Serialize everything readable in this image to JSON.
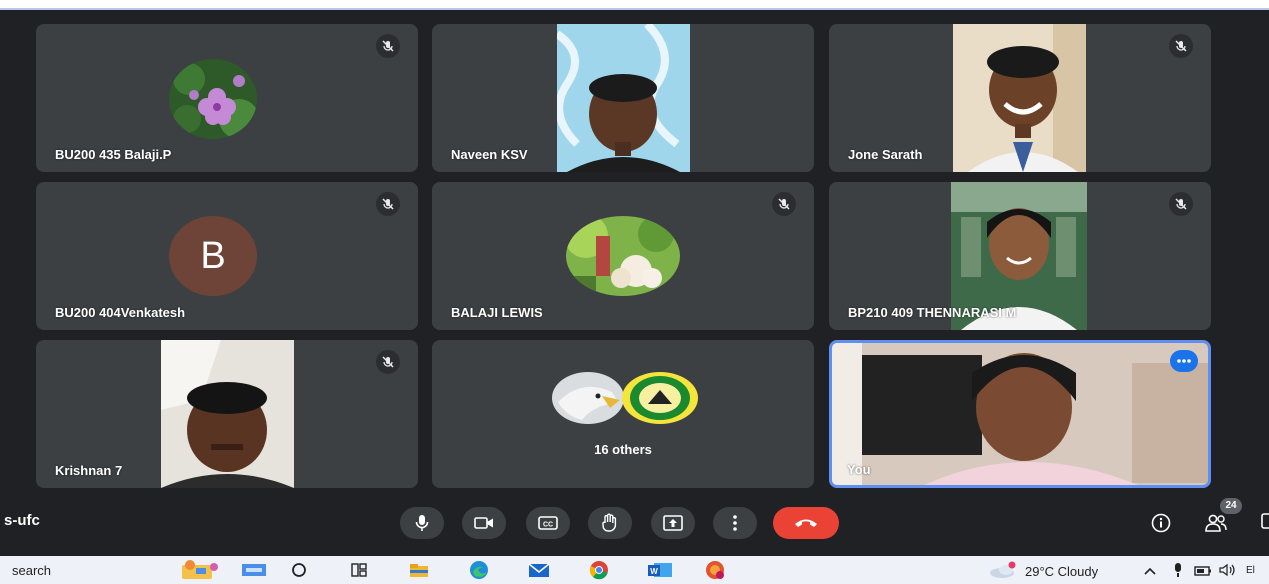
{
  "tiles": [
    {
      "name": "BU200 435 Balaji.P",
      "muted": true,
      "media": "flower-avatar"
    },
    {
      "name": "Naveen KSV",
      "muted": false,
      "media": "camera-video"
    },
    {
      "name": "Jone Sarath",
      "muted": true,
      "media": "camera-video"
    },
    {
      "name": "BU200 404Venkatesh",
      "muted": true,
      "media": "letter-avatar",
      "initial": "B",
      "avatar_color": "#6d4437"
    },
    {
      "name": "BALAJI LEWIS",
      "muted": true,
      "media": "photo-avatar"
    },
    {
      "name": "BP210 409 THENNARASI M",
      "muted": true,
      "media": "camera-video"
    },
    {
      "name": "Krishnan 7",
      "muted": true,
      "media": "camera-video"
    },
    {
      "others_label": "16 others",
      "media": "grouped-avatars"
    },
    {
      "name": "You",
      "media": "self-video",
      "active_speaker": true,
      "highlight_color": "#5f8ff0"
    }
  ],
  "meeting": {
    "code": "s-ufc",
    "participants_count": "24"
  },
  "controls": [
    {
      "name": "microphone-button",
      "icon": "microphone-icon"
    },
    {
      "name": "camera-button",
      "icon": "camera-icon"
    },
    {
      "name": "captions-button",
      "icon": "captions-icon"
    },
    {
      "name": "raise-hand-button",
      "icon": "hand-icon"
    },
    {
      "name": "present-button",
      "icon": "present-screen-icon"
    },
    {
      "name": "more-options-button",
      "icon": "more-vert-icon"
    },
    {
      "name": "leave-call-button",
      "icon": "hang-up-icon",
      "color": "#ea4335"
    }
  ],
  "taskbar": {
    "search_text": "search",
    "weather": "29°C Cloudy",
    "lang_hint": "El",
    "apps": [
      "widgets-icon",
      "cortana-icon",
      "task-view-icon",
      "file-explorer-icon",
      "edge-icon",
      "mail-icon",
      "chrome-icon",
      "word-icon",
      "profile-app-icon"
    ]
  },
  "colors": {
    "background": "#202124",
    "tile": "#3c4043",
    "leave": "#ea4335",
    "accent": "#1a73e8"
  }
}
